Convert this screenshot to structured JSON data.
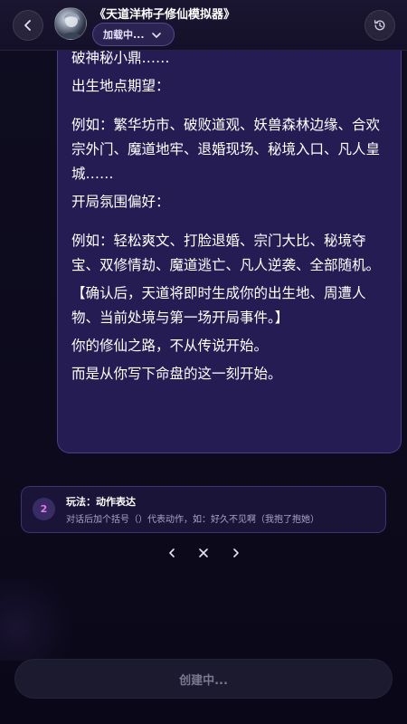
{
  "header": {
    "title": "《天道洋柿子修仙模拟器》",
    "status_label": "加载中...",
    "icons": {
      "back": "chevron-left-icon",
      "status": "chevron-down-icon",
      "history": "history-icon"
    }
  },
  "message": {
    "lines": [
      "破神秘小鼎……",
      "出生地点期望：",
      "",
      "例如：繁华坊市、破败道观、妖兽森林边缘、合欢宗外门、魔道地牢、退婚现场、秘境入口、凡人皇城……",
      "开局氛围偏好：",
      "",
      "例如：轻松爽文、打脸退婚、宗门大比、秘境夺宝、双修情劫、魔道逃亡、凡人逆袭、全部随机。",
      "【确认后，天道将即时生成你的出生地、周遭人物、当前处境与第一场开局事件。】",
      "你的修仙之路，不从传说开始。",
      "而是从你写下命盘的这一刻开始。"
    ]
  },
  "hint": {
    "number": "2",
    "title": "玩法：动作表达",
    "description": "对话后加个括号（）代表动作，如：好久不见啊（我抱了抱她）"
  },
  "pager": {
    "prev_icon": "chevron-left-icon",
    "close_icon": "close-icon",
    "next_icon": "chevron-right-icon"
  },
  "footer": {
    "create_label": "创建中..."
  },
  "colors": {
    "bubble_bg": "#241c52",
    "accent": "#e07be8",
    "bg": "#0c0a1c"
  }
}
